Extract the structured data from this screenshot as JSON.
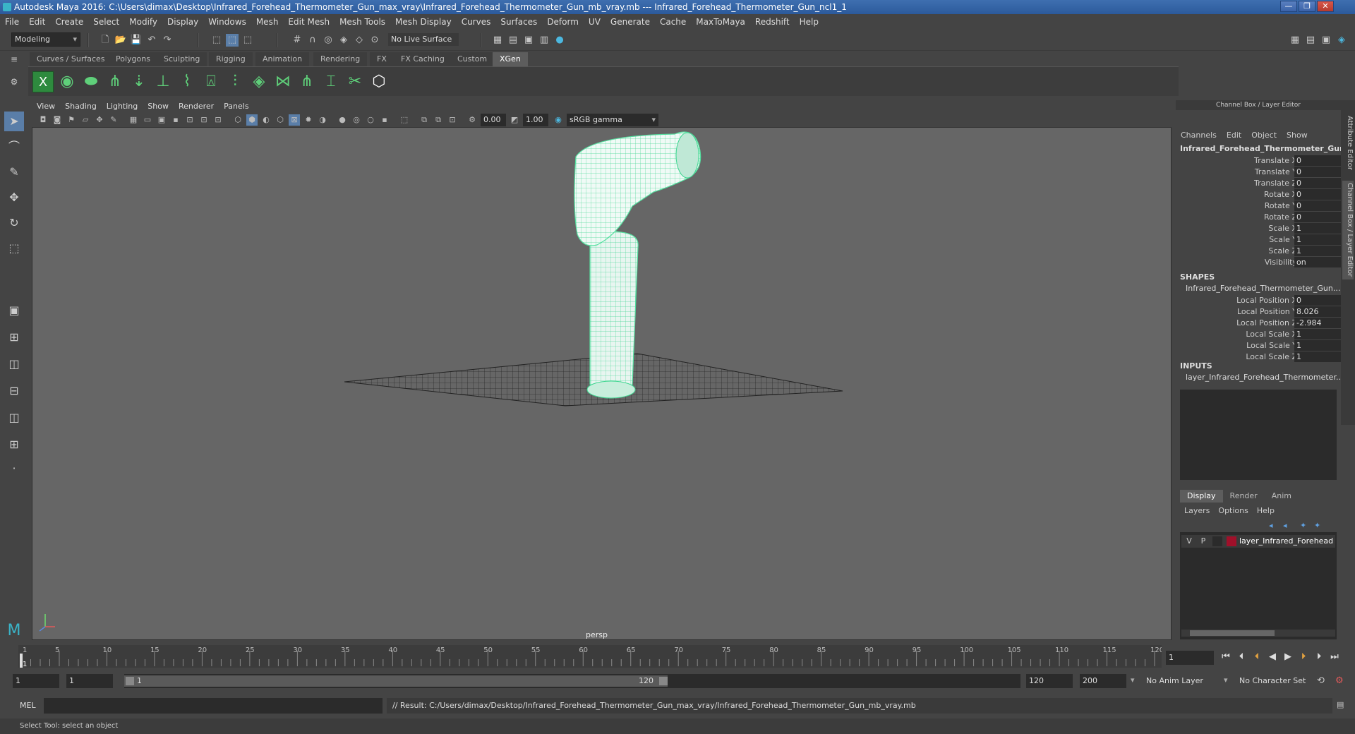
{
  "window": {
    "title": "Autodesk Maya 2016: C:\\Users\\dimax\\Desktop\\Infrared_Forehead_Thermometer_Gun_max_vray\\Infrared_Forehead_Thermometer_Gun_mb_vray.mb   ---   Infrared_Forehead_Thermometer_Gun_ncl1_1",
    "controls": [
      "—",
      "❐",
      "✕"
    ]
  },
  "menubar": [
    "File",
    "Edit",
    "Create",
    "Select",
    "Modify",
    "Display",
    "Windows",
    "Mesh",
    "Edit Mesh",
    "Mesh Tools",
    "Mesh Display",
    "Curves",
    "Surfaces",
    "Deform",
    "UV",
    "Generate",
    "Cache",
    "MaxToMaya",
    "Redshift",
    "Help"
  ],
  "statusline": {
    "mode": "Modeling",
    "live_surface": "No Live Surface"
  },
  "shelf_tabs": [
    {
      "label": "Curves / Surfaces",
      "active": false
    },
    {
      "label": "Polygons",
      "active": false
    },
    {
      "label": "Sculpting",
      "active": false
    },
    {
      "label": "Rigging",
      "active": false
    },
    {
      "label": "Animation",
      "active": false
    },
    {
      "label": "Rendering",
      "active": false
    },
    {
      "label": "FX",
      "active": false
    },
    {
      "label": "FX Caching",
      "active": false
    },
    {
      "label": "Custom",
      "active": false
    },
    {
      "label": "XGen",
      "active": true
    }
  ],
  "shelf_icons": [
    "xgen-icon",
    "eye-icon",
    "leaf-icon",
    "grass-icon",
    "placement-icon",
    "guide-icon",
    "spline-icon",
    "lock-icon",
    "hair-icon",
    "layers-icon",
    "comb-icon",
    "fur-icon",
    "clump-icon",
    "cut-icon",
    "hexagon-icon"
  ],
  "panel_menu": [
    "View",
    "Shading",
    "Lighting",
    "Show",
    "Renderer",
    "Panels"
  ],
  "panel_tools": {
    "exposure": "0.00",
    "gamma": "1.00",
    "color_space": "sRGB gamma"
  },
  "viewport": {
    "camera_label": "persp"
  },
  "channel_box": {
    "header": "Channel Box / Layer Editor",
    "menu": [
      "Channels",
      "Edit",
      "Object",
      "Show"
    ],
    "object_name": "Infrared_Forehead_Thermometer_Gun_n...",
    "attributes": [
      {
        "label": "Translate X",
        "value": "0"
      },
      {
        "label": "Translate Y",
        "value": "0"
      },
      {
        "label": "Translate Z",
        "value": "0"
      },
      {
        "label": "Rotate X",
        "value": "0"
      },
      {
        "label": "Rotate Y",
        "value": "0"
      },
      {
        "label": "Rotate Z",
        "value": "0"
      },
      {
        "label": "Scale X",
        "value": "1"
      },
      {
        "label": "Scale Y",
        "value": "1"
      },
      {
        "label": "Scale Z",
        "value": "1"
      },
      {
        "label": "Visibility",
        "value": "on"
      }
    ],
    "shapes_header": "SHAPES",
    "shape_name": "Infrared_Forehead_Thermometer_Gun...",
    "shape_attributes": [
      {
        "label": "Local Position X",
        "value": "0"
      },
      {
        "label": "Local Position Y",
        "value": "8.026"
      },
      {
        "label": "Local Position Z",
        "value": "-2.984"
      },
      {
        "label": "Local Scale X",
        "value": "1"
      },
      {
        "label": "Local Scale Y",
        "value": "1"
      },
      {
        "label": "Local Scale Z",
        "value": "1"
      }
    ],
    "inputs_header": "INPUTS",
    "input_name": "layer_Infrared_Forehead_Thermometer..."
  },
  "layer_editor": {
    "tabs": [
      {
        "label": "Display",
        "active": true
      },
      {
        "label": "Render",
        "active": false
      },
      {
        "label": "Anim",
        "active": false
      }
    ],
    "menu": [
      "Layers",
      "Options",
      "Help"
    ],
    "layer": {
      "v": "V",
      "p": "P",
      "color": "#a0102a",
      "name": "layer_Infrared_Forehead"
    }
  },
  "side_tabs": [
    "Attribute Editor",
    "Channel Box / Layer Editor"
  ],
  "timeline": {
    "ticks": [
      "1",
      "5",
      "10",
      "15",
      "20",
      "25",
      "30",
      "35",
      "40",
      "45",
      "50",
      "55",
      "60",
      "65",
      "70",
      "75",
      "80",
      "85",
      "90",
      "95",
      "100",
      "105",
      "110",
      "115",
      "120"
    ],
    "current_frame": "1"
  },
  "range": {
    "start": "1",
    "playback_start": "1",
    "slider_start": "1",
    "slider_end": "120",
    "playback_end": "120",
    "end": "200",
    "anim_layer": "No Anim Layer",
    "character_set": "No Character Set"
  },
  "command": {
    "label": "MEL",
    "result": "// Result: C:/Users/dimax/Desktop/Infrared_Forehead_Thermometer_Gun_max_vray/Infrared_Forehead_Thermometer_Gun_mb_vray.mb"
  },
  "help_line": "Select Tool: select an object",
  "colors": {
    "wireframe": "#55e0a0",
    "viewport_bg": "#666666",
    "accent": "#3e6fb0"
  }
}
